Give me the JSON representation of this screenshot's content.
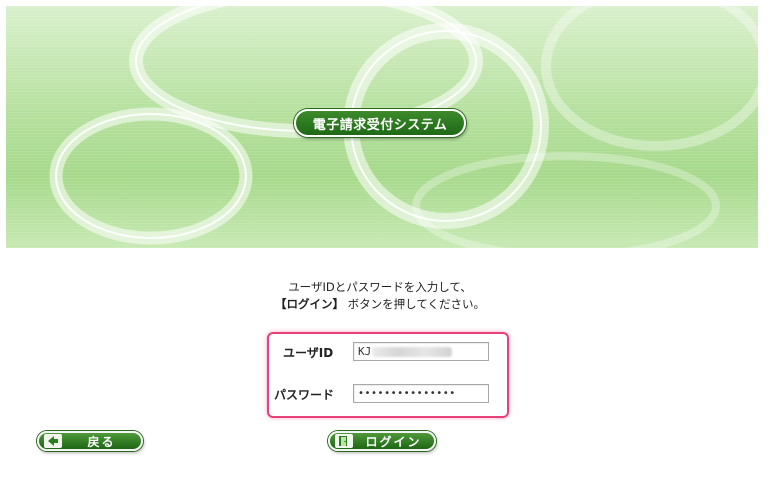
{
  "header": {
    "system_title": "電子請求受付システム"
  },
  "instructions": {
    "line1": "ユーザIDとパスワードを入力して、",
    "line2_bold": "【ログイン】",
    "line2_rest": "ボタンを押してください。"
  },
  "login_form": {
    "userid_label": "ユーザID",
    "userid_value": "KJ",
    "password_label": "パスワード",
    "password_value": "•••••••••••••••"
  },
  "buttons": {
    "back_label": "戻る",
    "login_label": "ログイン"
  },
  "colors": {
    "highlight_border": "#e8417a",
    "button_green": "#1d6614",
    "banner_green": "#a6d98b"
  }
}
